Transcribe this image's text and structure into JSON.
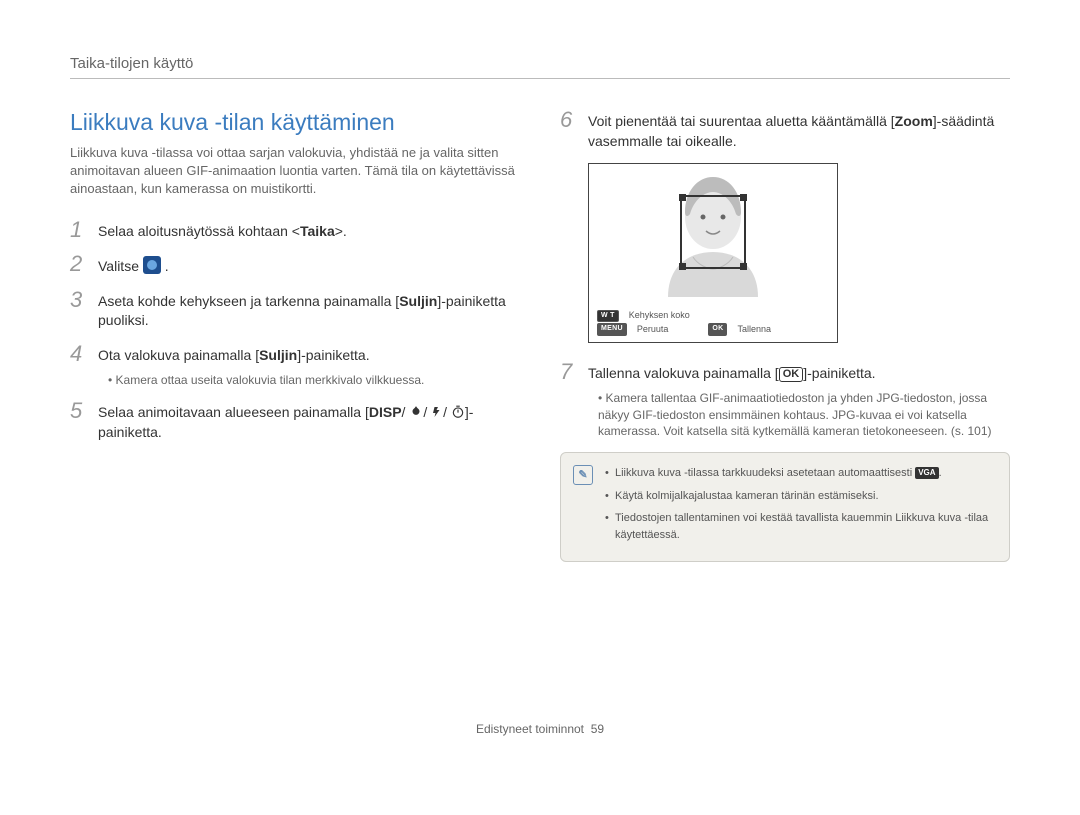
{
  "header": "Taika-tilojen käyttö",
  "title": "Liikkuva kuva -tilan käyttäminen",
  "intro": "Liikkuva kuva -tilassa voi ottaa sarjan valokuvia, yhdistää ne ja valita sitten animoitavan alueen GIF-animaation luontia varten. Tämä tila on käytettävissä ainoastaan, kun kamerassa on muistikortti.",
  "steps": {
    "s1": {
      "num": "1",
      "text_a": "Selaa aloitusnäytössä kohtaan <",
      "bold": "Taika",
      "text_b": ">."
    },
    "s2": {
      "num": "2",
      "text": "Valitse "
    },
    "s3": {
      "num": "3",
      "text_a": "Aseta kohde kehykseen ja tarkenna painamalla [",
      "bold": "Suljin",
      "text_b": "]-painiketta puoliksi."
    },
    "s4": {
      "num": "4",
      "text_a": "Ota valokuva painamalla [",
      "bold": "Suljin",
      "text_b": "]-painiketta.",
      "note": "Kamera ottaa useita valokuvia tilan merkkivalo vilkkuessa."
    },
    "s5": {
      "num": "5",
      "text_a": "Selaa animoitavaan alueeseen painamalla [",
      "disp": "DISP",
      "text_b": "]-painiketta."
    },
    "s6": {
      "num": "6",
      "text_a": "Voit pienentää tai suurentaa aluetta kääntämällä [",
      "bold": "Zoom",
      "text_b": "]-säädintä vasemmalle tai oikealle."
    },
    "s7": {
      "num": "7",
      "text_a": "Tallenna valokuva painamalla [",
      "text_b": "]-painiketta.",
      "note": "Kamera tallentaa GIF-animaatiotiedoston ja yhden JPG-tiedoston, jossa näkyy GIF-tiedoston ensimmäinen kohtaus. JPG-kuvaa ei voi katsella kamerassa. Voit katsella sitä kytkemällä kameran tietokoneeseen. (s. 101)"
    }
  },
  "screen": {
    "frame_size": "Kehyksen koko",
    "menu": "Peruuta",
    "ok": "Tallenna",
    "badge_wt": "W T",
    "badge_menu": "MENU",
    "badge_ok": "OK"
  },
  "notes": {
    "n1a": "Liikkuva kuva -tilassa tarkkuudeksi asetetaan automaattisesti ",
    "n1b": ".",
    "n2": "Käytä kolmijalkajalustaa kameran tärinän estämiseksi.",
    "n3": "Tiedostojen tallentaminen voi kestää tavallista kauemmin Liikkuva kuva -tilaa käytettäessä."
  },
  "vga": "VGA",
  "ok_symbol": "OK",
  "footer": {
    "text": "Edistyneet toiminnot",
    "page": "59"
  }
}
